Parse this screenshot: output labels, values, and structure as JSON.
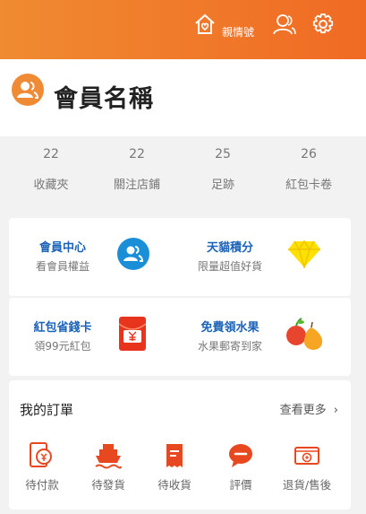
{
  "header": {
    "family_label": "親情號",
    "icons": [
      "family-home-icon",
      "account-icon",
      "settings-gear-icon"
    ],
    "gradient": [
      "#f08b31",
      "#f06a24"
    ]
  },
  "profile": {
    "member_name": "會員名稱",
    "avatar_icon": "member-avatar-icon",
    "avatar_color": "#ef8a35"
  },
  "stats": [
    {
      "count": "22",
      "label": "收藏夾"
    },
    {
      "count": "22",
      "label": "關注店鋪"
    },
    {
      "count": "25",
      "label": "足跡"
    },
    {
      "count": "26",
      "label": "紅包卡卷"
    }
  ],
  "promos": [
    {
      "title": "會員中心",
      "subtitle": "看會員權益",
      "icon": "member-center-icon"
    },
    {
      "title": "天貓積分",
      "subtitle": "限量超值好貨",
      "icon": "diamond-icon"
    },
    {
      "title": "紅包省錢卡",
      "subtitle": "領99元紅包",
      "icon": "red-envelope-icon"
    },
    {
      "title": "免費領水果",
      "subtitle": "水果郵寄到家",
      "icon": "fruit-icon"
    }
  ],
  "orders": {
    "title": "我的訂單",
    "more": "查看更多",
    "items": [
      {
        "label": "待付款",
        "icon": "payment-icon"
      },
      {
        "label": "待發貨",
        "icon": "shipping-icon"
      },
      {
        "label": "待收貨",
        "icon": "receipt-icon"
      },
      {
        "label": "評價",
        "icon": "review-icon"
      },
      {
        "label": "退貨/售後",
        "icon": "refund-icon"
      }
    ]
  },
  "colors": {
    "accent": "#e8481f",
    "link_blue": "#1b63b8"
  }
}
